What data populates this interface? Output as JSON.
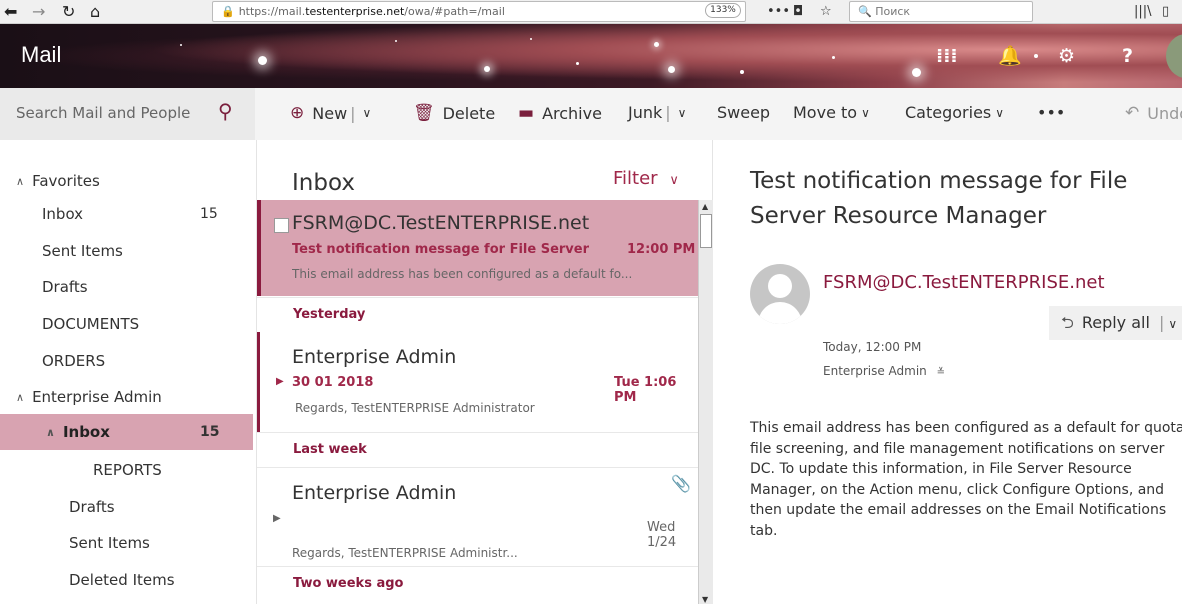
{
  "browser": {
    "url_prefix": "https://mail.",
    "url_domain": "testenterprise.net",
    "url_path": "/owa/#path=/mail",
    "zoom": "133%",
    "search_placeholder": "Поиск"
  },
  "app": {
    "name": "Mail"
  },
  "search": {
    "placeholder": "Search Mail and People"
  },
  "toolbar": {
    "new_label": "New",
    "delete_label": "Delete",
    "archive_label": "Archive",
    "junk_label": "Junk",
    "sweep_label": "Sweep",
    "move_to_label": "Move to",
    "categories_label": "Categories",
    "more_label": "•••",
    "undo_label": "Undo"
  },
  "folders": {
    "favorites_label": "Favorites",
    "items": [
      {
        "label": "Inbox",
        "count": "15"
      },
      {
        "label": "Sent Items"
      },
      {
        "label": "Drafts"
      },
      {
        "label": "DOCUMENTS"
      },
      {
        "label": "ORDERS"
      },
      {
        "label": "Enterprise Admin"
      },
      {
        "label": "Inbox",
        "count": "15"
      },
      {
        "label": "REPORTS"
      },
      {
        "label": "Drafts"
      },
      {
        "label": "Sent Items"
      },
      {
        "label": "Deleted Items"
      }
    ]
  },
  "message_list": {
    "title": "Inbox",
    "filter_label": "Filter",
    "messages": [
      {
        "sender": "FSRM@DC.TestENTERPRISE.net",
        "subject": "Test notification message for File Server Resource Manager",
        "time": "12:00 PM",
        "preview": "This email address has been configured as a default fo..."
      },
      {
        "sender": "Enterprise Admin",
        "subject": "30 01 2018",
        "time": "Tue 1:06 PM",
        "preview": "Regards, TestENTERPRISE Administrator"
      },
      {
        "sender": "Enterprise Admin",
        "time": "Wed 1/24",
        "preview": "Regards, TestENTERPRISE Administr..."
      }
    ],
    "groups": [
      "Yesterday",
      "Last week",
      "Two weeks ago"
    ]
  },
  "reading": {
    "title": "Test notification message for File Server Resource Manager",
    "from": "FSRM@DC.TestENTERPRISE.net",
    "reply_all_label": "Reply all",
    "date": "Today, 12:00 PM",
    "to": "Enterprise Admin",
    "body": "This email address has been configured as a default for quota, file screening, and file management notifications on server DC. To update this information, in File Server Resource Manager, on the Action menu, click Configure Options, and then update the email addresses on the Email Notifications tab."
  },
  "colors": {
    "accent": "#a0284a",
    "selected_bg": "#d8a3b1"
  }
}
